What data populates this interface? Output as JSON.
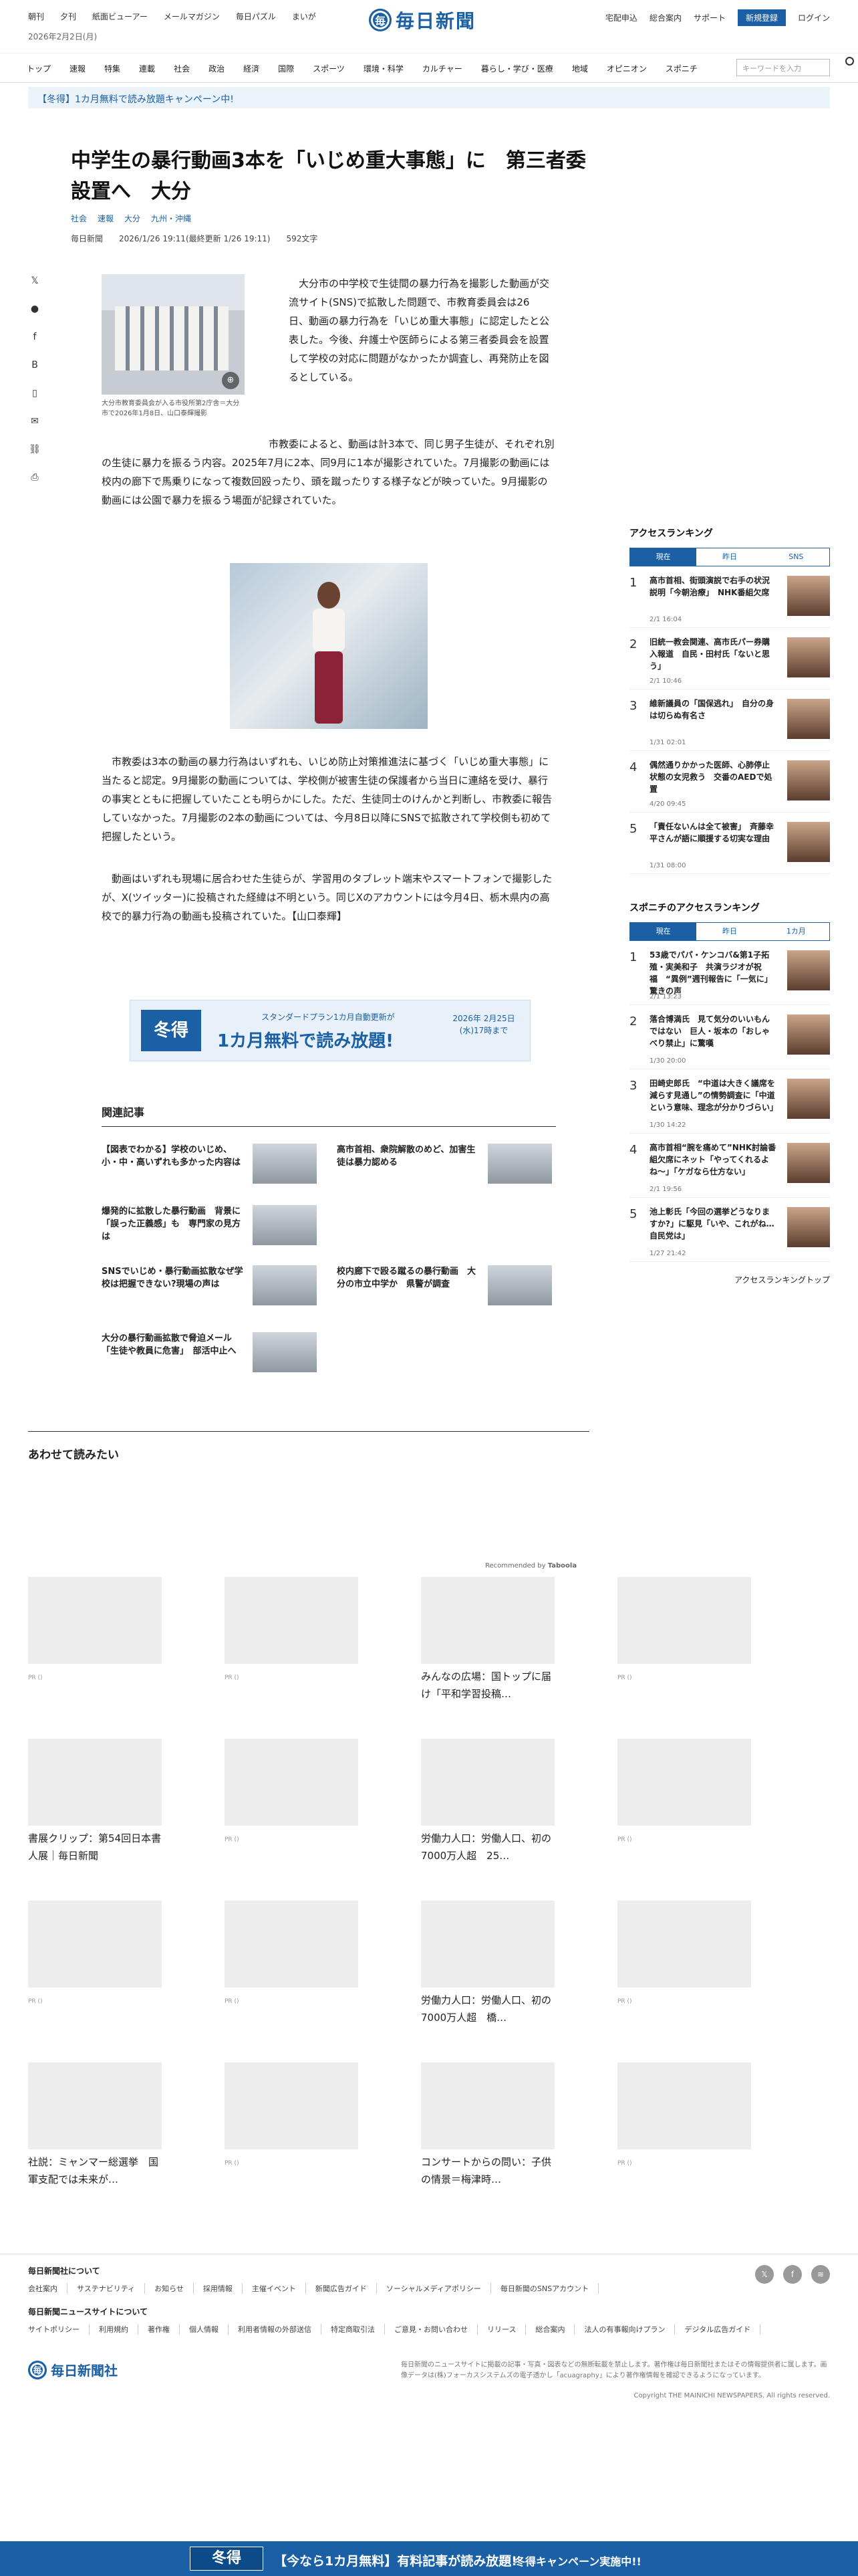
{
  "topnav_left": [
    "朝刊",
    "夕刊",
    "紙面ビューアー",
    "メールマガジン",
    "毎日パズル",
    "まいが"
  ],
  "date": "2026年2月2日(月)",
  "logo": "毎日新聞",
  "topnav_right": [
    "宅配申込",
    "総合案内",
    "サポート"
  ],
  "register": "新規登録",
  "login": "ログイン",
  "gnav": [
    "トップ",
    "速報",
    "特集",
    "連載",
    "社会",
    "政治",
    "経済",
    "国際",
    "スポーツ",
    "環境・科学",
    "カルチャー",
    "暮らし・学び・医療",
    "地域",
    "オピニオン",
    "スポニチ"
  ],
  "search_placeholder": "キーワードを入力",
  "campaign": "【冬得】1カ月無料で読み放題キャンペーン中!",
  "article": {
    "title": "中学生の暴行動画3本を「いじめ重大事態」に　第三者委設置へ　大分",
    "tags": [
      "社会",
      "速報",
      "大分",
      "九州・沖縄"
    ],
    "source": "毎日新聞",
    "datetime": "2026/1/26 19:11(最終更新 1/26 19:11)",
    "chars": "592文字",
    "photo_caption": "大分市教育委員会が入る市役所第2庁舎＝大分市で2026年1月8日、山口泰輝撮影",
    "p1": "大分市の中学校で生徒間の暴力行為を撮影した動画が交流サイト(SNS)で拡散した問題で、市教育委員会は26日、動画の暴力行為を「いじめ重大事態」に認定したと公表した。今後、弁護士や医師らによる第三者委員会を設置して学校の対応に問題がなかったか調査し、再発防止を図るとしている。",
    "p2": "市教委によると、動画は計3本で、同じ男子生徒が、それぞれ別の生徒に暴力を振るう内容。2025年7月に2本、同9月に1本が撮影されていた。7月撮影の動画には校内の廊下で馬乗りになって複数回殴ったり、頭を蹴ったりする様子などが映っていた。9月撮影の動画には公園で暴力を振るう場面が記録されていた。",
    "p3": "市教委は3本の動画の暴力行為はいずれも、いじめ防止対策推進法に基づく「いじめ重大事態」に当たると認定。9月撮影の動画については、学校側が被害生徒の保護者から当日に連絡を受け、暴行の事実とともに把握していたことも明らかにした。ただ、生徒同士のけんかと判断し、市教委に報告していなかった。7月撮影の2本の動画については、今月8日以降にSNSで拡散されて学校側も初めて把握したという。",
    "p4": "動画はいずれも現場に居合わせた生徒らが、学習用のタブレット端末やスマートフォンで撮影したが、X(ツイッター)に投稿された経緯は不明という。同じXのアカウントには今月4日、栃木県内の高校で的暴力行為の動画も投稿されていた。【山口泰輝】"
  },
  "banner": {
    "tag": "冬得",
    "sub": "スタンダードプラン1カ月自動更新が",
    "main": "1カ月無料で読み放題!",
    "deadline": "2026年 2月25日(水)17時まで"
  },
  "related": {
    "heading": "関連記事",
    "items": [
      "【図表でわかる】学校のいじめ、小・中・高いずれも多かった内容は",
      "高市首相、衆院解散のめど、加害生徒は暴力認める",
      "爆発的に拡散した暴行動画　背景に「誤った正義感」も　専門家の見方は",
      "校内廊下で殴る蹴るの暴行動画　大分の市立中学か　県警が調査",
      "SNSでいじめ・暴行動画拡散なぜ学校は把握できない?現場の声は",
      "大分の暴行動画拡散で脅迫メール　「生徒や教員に危害」　部活中止へ"
    ]
  },
  "ranking": {
    "title": "アクセスランキング",
    "tabs": [
      "現在",
      "昨日",
      "SNS"
    ],
    "items": [
      {
        "n": "1",
        "t": "高市首相、街頭演説で右手の状況説明「今朝治療」　NHK番組欠席",
        "d": "2/1 16:04"
      },
      {
        "n": "2",
        "t": "旧統一教会関連、高市氏パー券購入報道　自民・田村氏「ないと思う」",
        "d": "2/1 10:46"
      },
      {
        "n": "3",
        "t": "維新議員の「国保逃れ」　自分の身は切らぬ有名さ",
        "d": "1/31 02:01"
      },
      {
        "n": "4",
        "t": "偶然通りかかった医師、心肺停止状態の女児救う　交番のAEDで処置",
        "d": "4/20 09:45"
      },
      {
        "n": "5",
        "t": "「責任ないんは全て被害」　斉藤幸平さんが語に順援する切実な理由",
        "d": "1/31 08:00"
      }
    ]
  },
  "ranking2": {
    "title": "スポニチのアクセスランキング",
    "tabs": [
      "現在",
      "昨日",
      "1カ月"
    ],
    "items": [
      {
        "n": "1",
        "t": "53歳でパパ・ケンコバ&第1子拓殖・実美和子　共演ラジオが祝福　“異例”週刊報告に「一気に」驚きの声",
        "d": "2/1 13:23"
      },
      {
        "n": "2",
        "t": "落合博満氏　見て気分のいいもんではない　巨人・坂本の「おしゃべり禁止」に驚嘆",
        "d": "1/30 20:00"
      },
      {
        "n": "3",
        "t": "田崎史郎氏　“中道は大きく議席を減らす見通し”の情勢調査に「中道という意味、理念が分かりづらい」",
        "d": "1/30 14:22"
      },
      {
        "n": "4",
        "t": "高市首相“腕を痛めて”NHK討論番組欠席にネット「やってくれるよね〜」「ケガなら仕方ない」",
        "d": "2/1 19:56"
      },
      {
        "n": "5",
        "t": "池上彰氏「今回の選挙どうなりますか?」に駆見「いや、これがね…自民党は」",
        "d": "1/27 21:42"
      }
    ],
    "more": "アクセスランキングトップ"
  },
  "awase": {
    "heading": "あわせて読みたい",
    "recommended": "Recommended by",
    "brand": "Taboola",
    "tiles": [
      {
        "title": "",
        "pr": "PR ()"
      },
      {
        "title": "",
        "pr": "PR ()"
      },
      {
        "title": "みんなの広場：国トップに届け「平和学習投稿…",
        "pr": ""
      },
      {
        "title": "",
        "pr": "PR ()"
      },
      {
        "title": "書展クリップ：第54回日本書人展｜毎日新聞",
        "pr": ""
      },
      {
        "title": "",
        "pr": "PR ()"
      },
      {
        "title": "労働力人口：労働人口、初の7000万人超　25…",
        "pr": ""
      },
      {
        "title": "",
        "pr": "PR ()"
      },
      {
        "title": "",
        "pr": "PR ()"
      },
      {
        "title": "",
        "pr": "PR ()"
      },
      {
        "title": "労働力人口：労働人口、初の7000万人超　橋…",
        "pr": ""
      },
      {
        "title": "",
        "pr": "PR ()"
      },
      {
        "title": "社説：ミャンマー総選挙　国軍支配では未来が…",
        "pr": ""
      },
      {
        "title": "",
        "pr": "PR ()"
      },
      {
        "title": "コンサートからの問い：子供の情景＝梅津時…",
        "pr": ""
      },
      {
        "title": "",
        "pr": "PR ()"
      }
    ]
  },
  "footer": {
    "h1": "毎日新聞社について",
    "l1": [
      "会社案内",
      "サステナビリティ",
      "お知らせ",
      "採用情報",
      "主催イベント",
      "新聞広告ガイド",
      "ソーシャルメディアポリシー",
      "毎日新聞のSNSアカウント"
    ],
    "h2": "毎日新聞ニュースサイトについて",
    "l2": [
      "サイトポリシー",
      "利用規約",
      "著作権",
      "個人情報",
      "利用者情報の外部送信",
      "特定商取引法",
      "ご意見・お問い合わせ",
      "リリース",
      "総合案内",
      "法人の有事報向けプラン",
      "デジタル広告ガイド"
    ],
    "logo": "毎日新聞社",
    "note": "毎日新聞のニュースサイトに掲載の記事・写真・図表などの無断転載を禁止します。著作権は毎日新聞社またはその情報提供者に属します。画像データは(株)フォーカスシステムズの電子透かし「acuagraphy」により著作権情報を確認できるようになっています。",
    "copyright": "Copyright THE MAINICHI NEWSPAPERS. All rights reserved."
  },
  "bottom": {
    "tag": "冬得",
    "main": "【今なら1カ月無料】有料記事が読み放題!",
    "sub": "冬得キャンペーン実施中!!"
  }
}
